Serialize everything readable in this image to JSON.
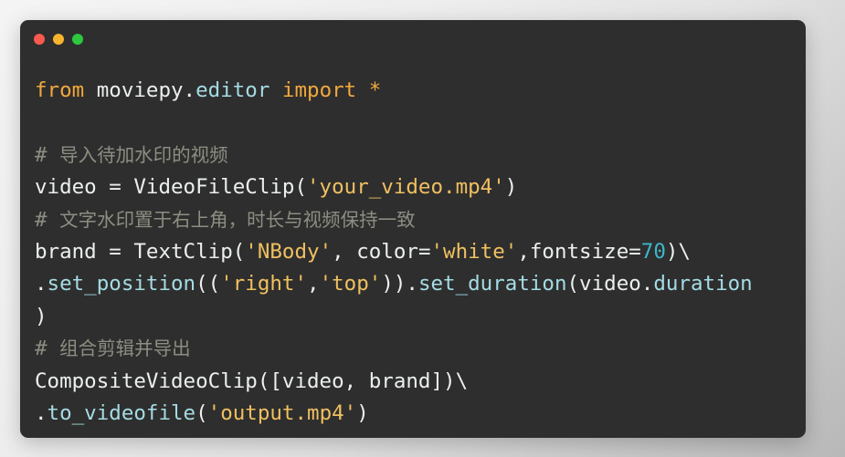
{
  "window": {
    "kind": "code-snippet-card",
    "background_color": "#2e2e2e",
    "page_background": "#e8e8e8",
    "traffic_lights": [
      {
        "name": "close",
        "color": "#f9594e"
      },
      {
        "name": "minimize",
        "color": "#f9b42d"
      },
      {
        "name": "maximize",
        "color": "#2dc83f"
      }
    ]
  },
  "theme": {
    "keyword": "#f2a93b",
    "plain": "#eceff0",
    "attribute": "#a5dce4",
    "function": "#a5dce4",
    "string": "#f0c060",
    "number": "#3fb6c9",
    "comment": "#8d8d82"
  },
  "code": {
    "language": "python",
    "plain_text": "from moviepy.editor import *\n\n# 导入待加水印的视频\nvideo = VideoFileClip('your_video.mp4')\n# 文字水印置于右上角，时长与视频保持一致\nbrand = TextClip('NBody', color='white',fontsize=70)\\\n.set_position(('right','top')).set_duration(video.duration)\n# 组合剪辑并导出\nCompositeVideoClip([video, brand])\\\n.to_videofile('output.mp4')",
    "lines": [
      {
        "id": "line-1",
        "tokens": [
          {
            "t": "from ",
            "c": "kw"
          },
          {
            "t": "moviepy.",
            "c": "plain"
          },
          {
            "t": "editor",
            "c": "attr"
          },
          {
            "t": " import ",
            "c": "kw"
          },
          {
            "t": "*",
            "c": "kw"
          }
        ]
      },
      {
        "id": "line-2",
        "tokens": [
          {
            "t": " ",
            "c": "plain"
          }
        ]
      },
      {
        "id": "line-3",
        "tokens": [
          {
            "t": "# ",
            "c": "comment"
          },
          {
            "t": "导入待加水印的视频",
            "c": "comment-cjk"
          }
        ]
      },
      {
        "id": "line-4",
        "tokens": [
          {
            "t": "video = VideoFileClip(",
            "c": "plain"
          },
          {
            "t": "'your_video.mp4'",
            "c": "str"
          },
          {
            "t": ")",
            "c": "plain"
          }
        ]
      },
      {
        "id": "line-5",
        "tokens": [
          {
            "t": "# ",
            "c": "comment"
          },
          {
            "t": "文字水印置于右上角，时长与视频保持一致",
            "c": "comment-cjk"
          }
        ]
      },
      {
        "id": "line-6",
        "tokens": [
          {
            "t": "brand = TextClip(",
            "c": "plain"
          },
          {
            "t": "'NBody'",
            "c": "str"
          },
          {
            "t": ", color=",
            "c": "plain"
          },
          {
            "t": "'white'",
            "c": "str"
          },
          {
            "t": ",fontsize=",
            "c": "plain"
          },
          {
            "t": "70",
            "c": "num"
          },
          {
            "t": ")\\",
            "c": "plain"
          }
        ]
      },
      {
        "id": "line-7",
        "tokens": [
          {
            "t": ".",
            "c": "plain"
          },
          {
            "t": "set_position",
            "c": "fn"
          },
          {
            "t": "((",
            "c": "plain"
          },
          {
            "t": "'right'",
            "c": "str"
          },
          {
            "t": ",",
            "c": "plain"
          },
          {
            "t": "'top'",
            "c": "str"
          },
          {
            "t": ")).",
            "c": "plain"
          },
          {
            "t": "set_duration",
            "c": "fn"
          },
          {
            "t": "(video.",
            "c": "plain"
          },
          {
            "t": "duration",
            "c": "attr"
          }
        ]
      },
      {
        "id": "line-8",
        "tokens": [
          {
            "t": ")",
            "c": "plain"
          }
        ]
      },
      {
        "id": "line-9",
        "tokens": [
          {
            "t": "# ",
            "c": "comment"
          },
          {
            "t": "组合剪辑并导出",
            "c": "comment-cjk"
          }
        ]
      },
      {
        "id": "line-10",
        "tokens": [
          {
            "t": "CompositeVideoClip([video, brand])\\",
            "c": "plain"
          }
        ]
      },
      {
        "id": "line-11",
        "tokens": [
          {
            "t": ".",
            "c": "plain"
          },
          {
            "t": "to_videofile",
            "c": "fn"
          },
          {
            "t": "(",
            "c": "plain"
          },
          {
            "t": "'output.mp4'",
            "c": "str"
          },
          {
            "t": ")",
            "c": "plain"
          }
        ]
      }
    ]
  }
}
